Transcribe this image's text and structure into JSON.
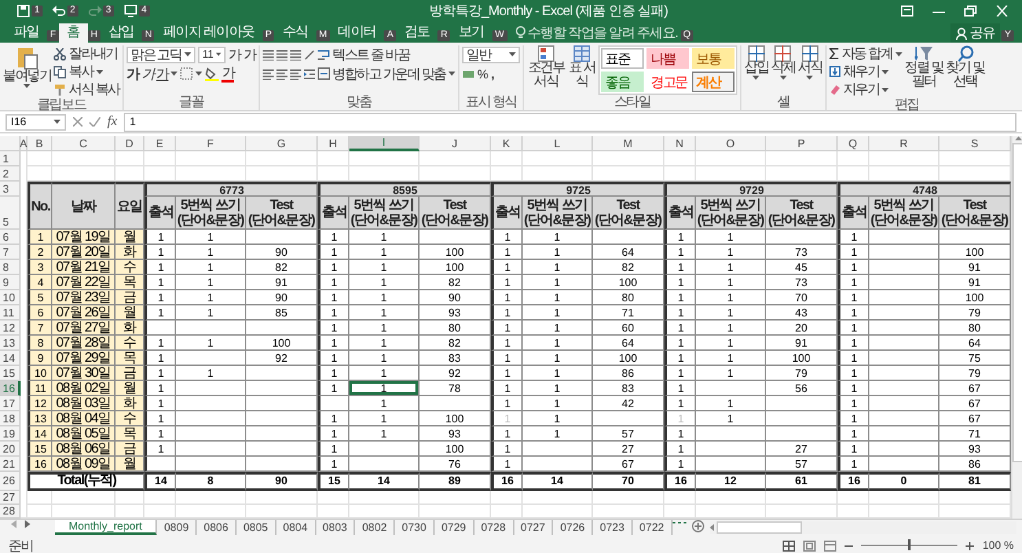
{
  "window": {
    "title": "방학특강_Monthly - Excel (제품 인증 실패)"
  },
  "quick_access": [
    {
      "kind": "save",
      "keytip": "1",
      "disabled": false
    },
    {
      "kind": "undo",
      "keytip": "2",
      "disabled": false
    },
    {
      "kind": "redo",
      "keytip": "3",
      "disabled": true
    },
    {
      "kind": "touch",
      "keytip": "4",
      "disabled": false
    }
  ],
  "tabs": [
    {
      "label": "파일",
      "keytip": "F",
      "selected": false
    },
    {
      "label": "홈",
      "keytip": "H",
      "selected": true
    },
    {
      "label": "삽입",
      "keytip": "N",
      "selected": false
    },
    {
      "label": "페이지 레이아웃",
      "keytip": "P",
      "selected": false
    },
    {
      "label": "수식",
      "keytip": "M",
      "selected": false
    },
    {
      "label": "데이터",
      "keytip": "A",
      "selected": false
    },
    {
      "label": "검토",
      "keytip": "R",
      "selected": false
    },
    {
      "label": "보기",
      "keytip": "W",
      "selected": false
    }
  ],
  "tell_me": {
    "placeholder": "수행할 작업을 알려 주세요.",
    "keytip": "Q"
  },
  "share": {
    "label": "공유",
    "keytip": "Y"
  },
  "ribbon": {
    "clipboard": {
      "title": "클립보드",
      "paste": "붙여넣기",
      "cut": "잘라내기",
      "copy": "복사",
      "format_painter": "서식 복사"
    },
    "font": {
      "title": "글꼴",
      "font_name": "맑은 고딕",
      "font_size": "11",
      "grow": "가",
      "shrink": "가",
      "bold": "가",
      "italic": "가",
      "underline": "가",
      "font_color": "가"
    },
    "alignment": {
      "title": "맞춤",
      "wrap_text": "텍스트 줄 바꿈",
      "merge_center": "병합하고 가운데 맞춤"
    },
    "number": {
      "title": "표시 형식",
      "format": "일반",
      "percent": "%",
      "comma": ","
    },
    "styles": {
      "title": "스타일",
      "conditional": "조건부 서식",
      "format_table": "표 서식",
      "cells": [
        {
          "label": "표준",
          "kind": "normal"
        },
        {
          "label": "나쁨",
          "kind": "bad"
        },
        {
          "label": "보통",
          "kind": "neutral"
        },
        {
          "label": "좋음",
          "kind": "good"
        },
        {
          "label": "경고문",
          "kind": "warning"
        },
        {
          "label": "계산",
          "kind": "calculation"
        }
      ]
    },
    "cells": {
      "title": "셀",
      "insert": "삽입",
      "delete": "삭제",
      "format": "서식"
    },
    "editing": {
      "title": "편집",
      "autosum": "자동 합계",
      "fill": "채우기",
      "clear": "지우기",
      "sort_filter": "정렬 및 필터",
      "find_select": "찾기 및 선택"
    }
  },
  "formula_bar": {
    "name_box": "I16",
    "function_label": "fx",
    "value": "1"
  },
  "sheet": {
    "column_letters": [
      {
        "letter": "A",
        "selected": false
      },
      {
        "letter": "B",
        "selected": false
      },
      {
        "letter": "C",
        "selected": false
      },
      {
        "letter": "D",
        "selected": false
      },
      {
        "letter": "E",
        "selected": false
      },
      {
        "letter": "F",
        "selected": false
      },
      {
        "letter": "G",
        "selected": false
      },
      {
        "letter": "H",
        "selected": false
      },
      {
        "letter": "I",
        "selected": true
      },
      {
        "letter": "J",
        "selected": false
      },
      {
        "letter": "K",
        "selected": false
      },
      {
        "letter": "L",
        "selected": false
      },
      {
        "letter": "M",
        "selected": false
      },
      {
        "letter": "N",
        "selected": false
      },
      {
        "letter": "O",
        "selected": false
      },
      {
        "letter": "P",
        "selected": false
      },
      {
        "letter": "Q",
        "selected": false
      },
      {
        "letter": "R",
        "selected": false
      },
      {
        "letter": "S",
        "selected": false
      }
    ],
    "row_numbers": [
      {
        "label": "1",
        "selected": false
      },
      {
        "label": "2",
        "selected": false
      },
      {
        "label": "3",
        "selected": false
      },
      {
        "label": "5",
        "selected": false
      },
      {
        "label": "6",
        "selected": false
      },
      {
        "label": "7",
        "selected": false
      },
      {
        "label": "8",
        "selected": false
      },
      {
        "label": "9",
        "selected": false
      },
      {
        "label": "10",
        "selected": false
      },
      {
        "label": "11",
        "selected": false
      },
      {
        "label": "12",
        "selected": false
      },
      {
        "label": "13",
        "selected": false
      },
      {
        "label": "14",
        "selected": false
      },
      {
        "label": "15",
        "selected": false
      },
      {
        "label": "16",
        "selected": true
      },
      {
        "label": "17",
        "selected": false
      },
      {
        "label": "18",
        "selected": false
      },
      {
        "label": "19",
        "selected": false
      },
      {
        "label": "20",
        "selected": false
      },
      {
        "label": "21",
        "selected": false
      },
      {
        "label": "26",
        "selected": false
      },
      {
        "label": "27",
        "selected": false
      },
      {
        "label": "28",
        "selected": false
      }
    ],
    "head": {
      "no": "No.",
      "date": "날짜",
      "weekday": "요일"
    },
    "groups": [
      {
        "label": "6773",
        "columns": [
          [
            "출석"
          ],
          [
            "5번씩 쓰기",
            "(단어&문장)"
          ],
          [
            "Test",
            "(단어&문장)"
          ]
        ]
      },
      {
        "label": "8595",
        "columns": [
          [
            "출석"
          ],
          [
            "5번씩 쓰기",
            "(단어&문장)"
          ],
          [
            "Test",
            "(단어&문장)"
          ]
        ]
      },
      {
        "label": "9725",
        "columns": [
          [
            "출석"
          ],
          [
            "5번씩 쓰기",
            "(단어&문장)"
          ],
          [
            "Test",
            "(단어&문장)"
          ]
        ]
      },
      {
        "label": "9729",
        "columns": [
          [
            "출석"
          ],
          [
            "5번씩 쓰기",
            "(단어&문장)"
          ],
          [
            "Test",
            "(단어&문장)"
          ]
        ]
      },
      {
        "label": "4748",
        "columns": [
          [
            "출석"
          ],
          [
            "5번씩 쓰기",
            "(단어&문장)"
          ],
          [
            "Test",
            "(단어&문장)"
          ]
        ]
      }
    ],
    "rows": [
      {
        "no": "1",
        "date": "07월 19일",
        "weekday": "월",
        "cells": [
          "1",
          "1",
          null,
          "1",
          "1",
          null,
          "1",
          "1",
          null,
          "1",
          "1",
          null,
          "1",
          null,
          null
        ]
      },
      {
        "no": "2",
        "date": "07월 20일",
        "weekday": "화",
        "cells": [
          "1",
          "1",
          "90",
          "1",
          "1",
          "100",
          "1",
          "1",
          "64",
          "1",
          "1",
          "73",
          "1",
          null,
          "100"
        ]
      },
      {
        "no": "3",
        "date": "07월 21일",
        "weekday": "수",
        "cells": [
          "1",
          "1",
          "82",
          "1",
          "1",
          "100",
          "1",
          "1",
          "82",
          "1",
          "1",
          "45",
          "1",
          null,
          "91"
        ]
      },
      {
        "no": "4",
        "date": "07월 22일",
        "weekday": "목",
        "cells": [
          "1",
          "1",
          "91",
          "1",
          "1",
          "82",
          "1",
          "1",
          "100",
          "1",
          "1",
          "73",
          "1",
          null,
          "91"
        ]
      },
      {
        "no": "5",
        "date": "07월 23일",
        "weekday": "금",
        "cells": [
          "1",
          "1",
          "90",
          "1",
          "1",
          "90",
          "1",
          "1",
          "80",
          "1",
          "1",
          "70",
          "1",
          null,
          "100"
        ]
      },
      {
        "no": "6",
        "date": "07월 26일",
        "weekday": "월",
        "cells": [
          "1",
          "1",
          "85",
          "1",
          "1",
          "93",
          "1",
          "1",
          "71",
          "1",
          "1",
          "43",
          "1",
          null,
          "79"
        ]
      },
      {
        "no": "7",
        "date": "07월 27일",
        "weekday": "화",
        "cells": [
          null,
          null,
          null,
          "1",
          "1",
          "80",
          "1",
          "1",
          "60",
          "1",
          "1",
          "20",
          "1",
          null,
          "80"
        ]
      },
      {
        "no": "8",
        "date": "07월 28일",
        "weekday": "수",
        "cells": [
          "1",
          "1",
          "100",
          "1",
          "1",
          "82",
          "1",
          "1",
          "64",
          "1",
          "1",
          "91",
          "1",
          null,
          "64"
        ]
      },
      {
        "no": "9",
        "date": "07월 29일",
        "weekday": "목",
        "cells": [
          "1",
          null,
          "92",
          "1",
          "1",
          "83",
          "1",
          "1",
          "100",
          "1",
          "1",
          "100",
          "1",
          null,
          "75"
        ]
      },
      {
        "no": "10",
        "date": "07월 30일",
        "weekday": "금",
        "cells": [
          "1",
          "1",
          null,
          "1",
          "1",
          "92",
          "1",
          "1",
          "86",
          "1",
          "1",
          "79",
          "1",
          null,
          "79"
        ]
      },
      {
        "no": "11",
        "date": "08월 02일",
        "weekday": "월",
        "cells": [
          "1",
          null,
          null,
          "1",
          "1",
          "78",
          "1",
          "1",
          "83",
          "1",
          null,
          "56",
          "1",
          null,
          "67"
        ]
      },
      {
        "no": "12",
        "date": "08월 03일",
        "weekday": "화",
        "cells": [
          "1",
          null,
          null,
          null,
          "1",
          null,
          "1",
          "1",
          "42",
          "1",
          "1",
          null,
          "1",
          null,
          "67"
        ]
      },
      {
        "no": "13",
        "date": "08월 04일",
        "weekday": "수",
        "cells": [
          "1",
          null,
          null,
          "1",
          "1",
          "100",
          {
            "text": "1",
            "faint": true
          },
          "1",
          null,
          {
            "text": "1",
            "faint": true
          },
          "1",
          null,
          "1",
          null,
          "67"
        ]
      },
      {
        "no": "14",
        "date": "08월 05일",
        "weekday": "목",
        "cells": [
          "1",
          null,
          null,
          "1",
          "1",
          "93",
          "1",
          "1",
          "57",
          "1",
          null,
          null,
          "1",
          null,
          "71"
        ]
      },
      {
        "no": "15",
        "date": "08월 06일",
        "weekday": "금",
        "cells": [
          "1",
          null,
          null,
          "1",
          null,
          "100",
          "1",
          null,
          "27",
          "1",
          null,
          "27",
          "1",
          null,
          "93"
        ]
      },
      {
        "no": "16",
        "date": "08월 09일",
        "weekday": "월",
        "cells": [
          null,
          null,
          null,
          "1",
          null,
          "76",
          "1",
          null,
          "67",
          "1",
          null,
          "57",
          "1",
          null,
          "86"
        ]
      }
    ],
    "total": {
      "label": "Total(누적)",
      "cells": [
        "14",
        "8",
        "90",
        "15",
        "14",
        "89",
        "16",
        "14",
        "70",
        "16",
        "12",
        "61",
        "16",
        "0",
        "81"
      ]
    }
  },
  "sheet_tabs": [
    {
      "label": "Monthly_report",
      "selected": true
    },
    {
      "label": "0809",
      "selected": false
    },
    {
      "label": "0806",
      "selected": false
    },
    {
      "label": "0805",
      "selected": false
    },
    {
      "label": "0804",
      "selected": false
    },
    {
      "label": "0803",
      "selected": false
    },
    {
      "label": "0802",
      "selected": false
    },
    {
      "label": "0730",
      "selected": false
    },
    {
      "label": "0729",
      "selected": false
    },
    {
      "label": "0728",
      "selected": false
    },
    {
      "label": "0727",
      "selected": false
    },
    {
      "label": "0726",
      "selected": false
    },
    {
      "label": "0723",
      "selected": false
    },
    {
      "label": "0722",
      "selected": false
    }
  ],
  "status_bar": {
    "text": "준비",
    "zoom": {
      "level": 0.5,
      "reading": "100 %"
    }
  }
}
